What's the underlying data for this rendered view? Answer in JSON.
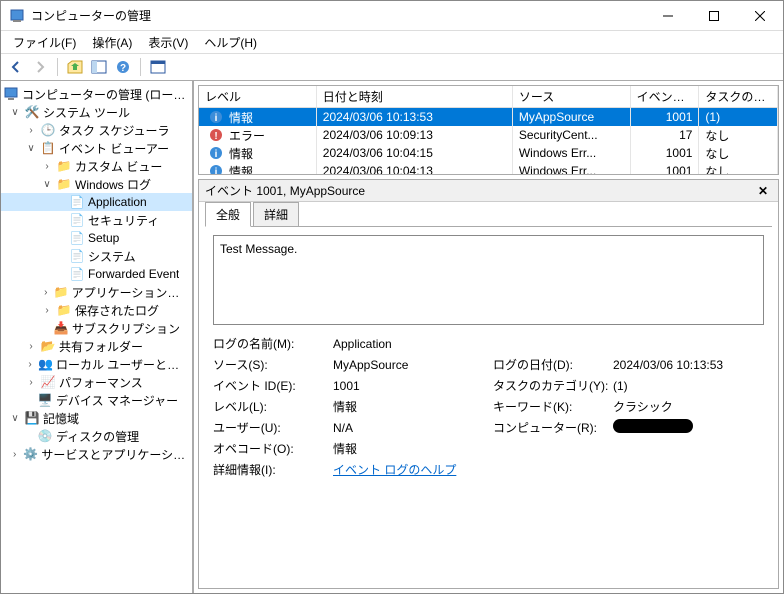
{
  "window": {
    "title": "コンピューターの管理"
  },
  "menu": {
    "file": "ファイル(F)",
    "action": "操作(A)",
    "view": "表示(V)",
    "help": "ヘルプ(H)"
  },
  "tree": {
    "root": "コンピューターの管理 (ローカル)",
    "system_tools": "システム ツール",
    "task_scheduler": "タスク スケジューラ",
    "event_viewer": "イベント ビューアー",
    "custom_views": "カスタム ビュー",
    "windows_logs": "Windows ログ",
    "application": "Application",
    "security": "セキュリティ",
    "setup": "Setup",
    "system": "システム",
    "forwarded": "Forwarded Event",
    "apps_services": "アプリケーションとサービ",
    "saved_logs": "保存されたログ",
    "subscriptions": "サブスクリプション",
    "shared_folders": "共有フォルダー",
    "local_users": "ローカル ユーザーとグループ",
    "performance": "パフォーマンス",
    "device_mgr": "デバイス マネージャー",
    "storage": "記憶域",
    "disk_mgmt": "ディスクの管理",
    "services_apps": "サービスとアプリケーション"
  },
  "list": {
    "headers": {
      "level": "レベル",
      "date": "日付と時刻",
      "source": "ソース",
      "id": "イベント ID",
      "category": "タスクのカテゴリ"
    },
    "rows": [
      {
        "level": "情報",
        "date": "2024/03/06 10:13:53",
        "source": "MyAppSource",
        "id": "1001",
        "category": "(1)",
        "icon": "info",
        "selected": true
      },
      {
        "level": "エラー",
        "date": "2024/03/06 10:09:13",
        "source": "SecurityCent...",
        "id": "17",
        "category": "なし",
        "icon": "error"
      },
      {
        "level": "情報",
        "date": "2024/03/06 10:04:15",
        "source": "Windows Err...",
        "id": "1001",
        "category": "なし",
        "icon": "info"
      },
      {
        "level": "情報",
        "date": "2024/03/06 10:04:13",
        "source": "Windows Err...",
        "id": "1001",
        "category": "なし",
        "icon": "info"
      }
    ]
  },
  "detail": {
    "title": "イベント 1001, MyAppSource",
    "tabs": {
      "general": "全般",
      "details": "詳細"
    },
    "message": "Test Message.",
    "props": {
      "log_name_l": "ログの名前(M):",
      "log_name_v": "Application",
      "source_l": "ソース(S):",
      "source_v": "MyAppSource",
      "log_date_l": "ログの日付(D):",
      "log_date_v": "2024/03/06 10:13:53",
      "event_id_l": "イベント ID(E):",
      "event_id_v": "1001",
      "task_cat_l": "タスクのカテゴリ(Y):",
      "task_cat_v": "(1)",
      "level_l": "レベル(L):",
      "level_v": "情報",
      "keywords_l": "キーワード(K):",
      "keywords_v": "クラシック",
      "user_l": "ユーザー(U):",
      "user_v": "N/A",
      "computer_l": "コンピューター(R):",
      "opcode_l": "オペコード(O):",
      "opcode_v": "情報",
      "more_info_l": "詳細情報(I):",
      "more_info_v": "イベント ログのヘルプ"
    }
  }
}
